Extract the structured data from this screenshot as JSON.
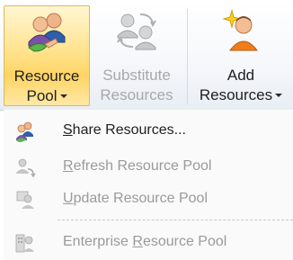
{
  "ribbon": {
    "resource_pool": {
      "line1": "Resource",
      "line2": "Pool"
    },
    "substitute_resources": {
      "line1": "Substitute",
      "line2": "Resources"
    },
    "add_resources": {
      "line1": "Add",
      "line2": "Resources"
    }
  },
  "menu": {
    "items": [
      {
        "pre": "",
        "key": "S",
        "post": "hare Resources...",
        "enabled": true
      },
      {
        "pre": "",
        "key": "R",
        "post": "efresh Resource Pool",
        "enabled": false
      },
      {
        "pre": "",
        "key": "U",
        "post": "pdate Resource Pool",
        "enabled": false
      },
      {
        "pre": "Enterprise ",
        "key": "R",
        "post": "esource Pool",
        "enabled": false
      }
    ]
  },
  "colors": {
    "active_button": "#ffd464",
    "disabled_text": "#9a9a9a"
  }
}
